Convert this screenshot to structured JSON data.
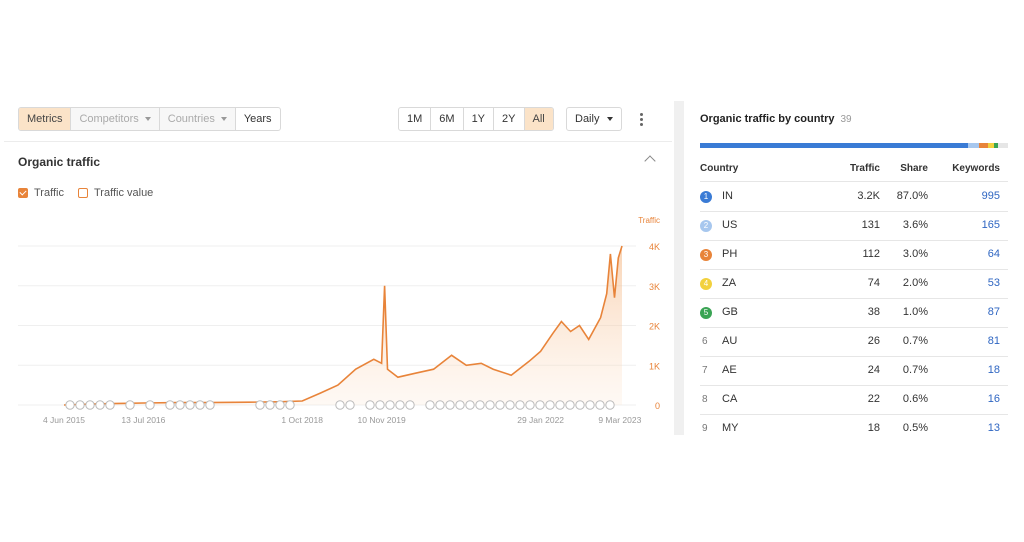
{
  "toolbar": {
    "tabs": [
      {
        "label": "Metrics",
        "state": "active"
      },
      {
        "label": "Competitors",
        "state": "disabled"
      },
      {
        "label": "Countries",
        "state": "disabled"
      },
      {
        "label": "Years",
        "state": "normal"
      }
    ],
    "ranges": [
      "1M",
      "6M",
      "1Y",
      "2Y",
      "All"
    ],
    "range_selected": "All",
    "interval": "Daily"
  },
  "section": {
    "title": "Organic traffic",
    "legend": [
      {
        "label": "Traffic",
        "checked": true,
        "color": "#e8843a"
      },
      {
        "label": "Traffic value",
        "checked": false,
        "color": "#e8843a"
      }
    ]
  },
  "chart_data": {
    "type": "area",
    "title": "Organic traffic",
    "series": [
      {
        "name": "Traffic",
        "color": "#e8843a"
      }
    ],
    "yaxis": {
      "label": "Traffic",
      "ticks": [
        "4K",
        "3K",
        "2K",
        "1K",
        "0"
      ],
      "range": [
        0,
        4000
      ]
    },
    "xaxis": {
      "ticks": [
        "4 Jun 2015",
        "13 Jul 2016",
        "1 Oct 2018",
        "10 Nov 2019",
        "29 Jan 2022",
        "9 Mar 2023"
      ]
    },
    "points": [
      [
        "2015-06-04",
        0
      ],
      [
        "2015-10-01",
        20
      ],
      [
        "2016-02-01",
        35
      ],
      [
        "2016-07-13",
        50
      ],
      [
        "2017-01-01",
        60
      ],
      [
        "2017-06-01",
        60
      ],
      [
        "2018-01-01",
        70
      ],
      [
        "2018-06-01",
        80
      ],
      [
        "2018-10-01",
        100
      ],
      [
        "2019-01-01",
        300
      ],
      [
        "2019-04-01",
        500
      ],
      [
        "2019-07-01",
        900
      ],
      [
        "2019-10-01",
        1150
      ],
      [
        "2019-11-10",
        1050
      ],
      [
        "2019-11-25",
        3000
      ],
      [
        "2019-12-10",
        900
      ],
      [
        "2020-02-01",
        700
      ],
      [
        "2020-05-01",
        800
      ],
      [
        "2020-08-01",
        900
      ],
      [
        "2020-11-01",
        1250
      ],
      [
        "2021-01-15",
        1000
      ],
      [
        "2021-04-01",
        1050
      ],
      [
        "2021-06-01",
        900
      ],
      [
        "2021-09-01",
        750
      ],
      [
        "2021-12-01",
        1100
      ],
      [
        "2022-01-29",
        1350
      ],
      [
        "2022-04-01",
        1800
      ],
      [
        "2022-05-15",
        2100
      ],
      [
        "2022-07-01",
        1850
      ],
      [
        "2022-08-15",
        2000
      ],
      [
        "2022-10-01",
        1650
      ],
      [
        "2022-12-01",
        2200
      ],
      [
        "2023-01-01",
        2800
      ],
      [
        "2023-01-20",
        3800
      ],
      [
        "2023-02-10",
        2700
      ],
      [
        "2023-03-01",
        3700
      ],
      [
        "2023-03-20",
        4000
      ]
    ]
  },
  "countries_panel": {
    "title": "Organic traffic by country",
    "count": "39",
    "share_bar": [
      {
        "code": "IN",
        "share": 87.0,
        "color": "#3a7bd5"
      },
      {
        "code": "US",
        "share": 3.6,
        "color": "#a7c7ee"
      },
      {
        "code": "PH",
        "share": 3.0,
        "color": "#e8843a"
      },
      {
        "code": "ZA",
        "share": 2.0,
        "color": "#f2d13e"
      },
      {
        "code": "GB",
        "share": 1.0,
        "color": "#3aa454"
      },
      {
        "code": "other",
        "share": 3.4,
        "color": "#e6e6e6"
      }
    ],
    "columns": [
      "Country",
      "Traffic",
      "Share",
      "Keywords"
    ],
    "rows": [
      {
        "rank": "1",
        "code": "IN",
        "traffic": "3.2K",
        "share": "87.0%",
        "keywords": "995",
        "badge": "#3a7bd5"
      },
      {
        "rank": "2",
        "code": "US",
        "traffic": "131",
        "share": "3.6%",
        "keywords": "165",
        "badge": "#a7c7ee"
      },
      {
        "rank": "3",
        "code": "PH",
        "traffic": "112",
        "share": "3.0%",
        "keywords": "64",
        "badge": "#e8843a"
      },
      {
        "rank": "4",
        "code": "ZA",
        "traffic": "74",
        "share": "2.0%",
        "keywords": "53",
        "badge": "#f2d13e"
      },
      {
        "rank": "5",
        "code": "GB",
        "traffic": "38",
        "share": "1.0%",
        "keywords": "87",
        "badge": "#3aa454"
      },
      {
        "rank": "6",
        "code": "AU",
        "traffic": "26",
        "share": "0.7%",
        "keywords": "81",
        "badge": ""
      },
      {
        "rank": "7",
        "code": "AE",
        "traffic": "24",
        "share": "0.7%",
        "keywords": "18",
        "badge": ""
      },
      {
        "rank": "8",
        "code": "CA",
        "traffic": "22",
        "share": "0.6%",
        "keywords": "16",
        "badge": ""
      },
      {
        "rank": "9",
        "code": "MY",
        "traffic": "18",
        "share": "0.5%",
        "keywords": "13",
        "badge": ""
      }
    ]
  }
}
